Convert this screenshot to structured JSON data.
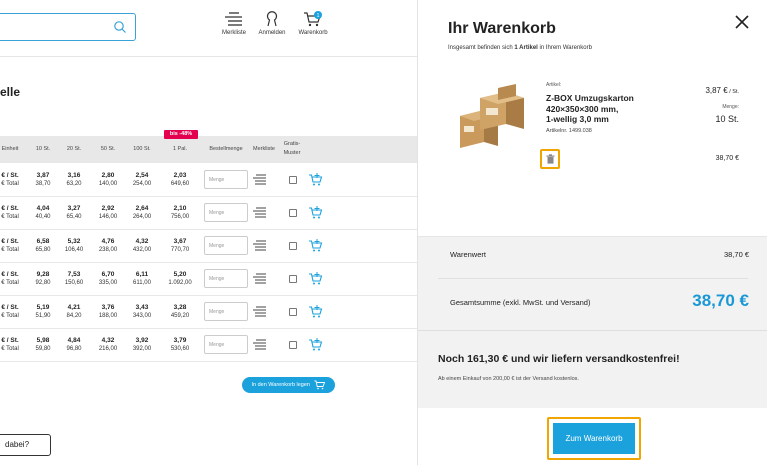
{
  "header": {
    "merkliste_label": "Merkliste",
    "anmelden_label": "Anmelden",
    "warenkorb_label": "Warenkorb",
    "cart_count": "1"
  },
  "page": {
    "title_fragment": "elle",
    "columns": [
      "Einheit",
      "10 St.",
      "20 St.",
      "50 St.",
      "100 St.",
      "1 Pal.",
      "Bestellmenge",
      "Merkliste",
      "Gratis-",
      "Muster"
    ],
    "deal_badge": "bis -48%",
    "qty_placeholder": "Menge",
    "add_to_cart_label": "In den Warenkorb legen",
    "bottom_button_label": "dabei?",
    "rows": [
      {
        "unit": "€ / St.",
        "unit_sub": "€ Total",
        "p10": "3,87",
        "t10": "38,70",
        "p20": "3,16",
        "t20": "63,20",
        "p50": "2,80",
        "t50": "140,00",
        "p100": "2,54",
        "t100": "254,00",
        "ppal": "2,03",
        "tpal": "649,60"
      },
      {
        "unit": "€ / St.",
        "unit_sub": "€ Total",
        "p10": "4,04",
        "t10": "40,40",
        "p20": "3,27",
        "t20": "65,40",
        "p50": "2,92",
        "t50": "146,00",
        "p100": "2,64",
        "t100": "264,00",
        "ppal": "2,10",
        "tpal": "756,00"
      },
      {
        "unit": "€ / St.",
        "unit_sub": "€ Total",
        "p10": "6,58",
        "t10": "65,80",
        "p20": "5,32",
        "t20": "106,40",
        "p50": "4,76",
        "t50": "238,00",
        "p100": "4,32",
        "t100": "432,00",
        "ppal": "3,67",
        "tpal": "770,70"
      },
      {
        "unit": "€ / St.",
        "unit_sub": "€ Total",
        "p10": "9,28",
        "t10": "92,80",
        "p20": "7,53",
        "t20": "150,60",
        "p50": "6,70",
        "t50": "335,00",
        "p100": "6,11",
        "t100": "611,00",
        "ppal": "5,20",
        "tpal": "1.092,00"
      },
      {
        "unit": "€ / St.",
        "unit_sub": "€ Total",
        "p10": "5,19",
        "t10": "51,90",
        "p20": "4,21",
        "t20": "84,20",
        "p50": "3,76",
        "t50": "188,00",
        "p100": "3,43",
        "t100": "343,00",
        "ppal": "3,28",
        "tpal": "459,20"
      },
      {
        "unit": "€ / St.",
        "unit_sub": "€ Total",
        "p10": "5,98",
        "t10": "59,80",
        "p20": "4,84",
        "t20": "96,80",
        "p50": "4,32",
        "t50": "216,00",
        "p100": "3,92",
        "t100": "392,00",
        "ppal": "3,79",
        "tpal": "530,60"
      }
    ]
  },
  "cart": {
    "title": "Ihr Warenkorb",
    "subtitle_pre": "Insgesamt befinden sich ",
    "subtitle_count": "1 Artikel",
    "subtitle_post": " in Ihrem Warenkorb",
    "item": {
      "label": "Artikel:",
      "name_line1": "Z-BOX Umzugskarton",
      "name_line2": "420×350×300 mm,",
      "name_line3": "1-wellig 3,0 mm",
      "article_no": "Artikelnr. 1499.038",
      "unit_price": "3,87 €",
      "unit_suffix": " / St.",
      "menge_label": "Menge:",
      "quantity": "10 St.",
      "total": "38,70 €"
    },
    "warenwert_label": "Warenwert",
    "warenwert_value": "38,70 €",
    "gesamt_label": "Gesamtsumme (exkl. MwSt. und Versand)",
    "gesamt_value": "38,70 €",
    "free_shipping_msg": "Noch 161,30 € und wir liefern versandkostenfrei!",
    "free_shipping_sub": "Ab einem Einkauf von 200,00 € ist der Versand kostenlos.",
    "checkout_label": "Zum Warenkorb"
  },
  "colors": {
    "accent": "#1ba2dd",
    "highlight": "#f0a500",
    "badge": "#e2004f"
  }
}
